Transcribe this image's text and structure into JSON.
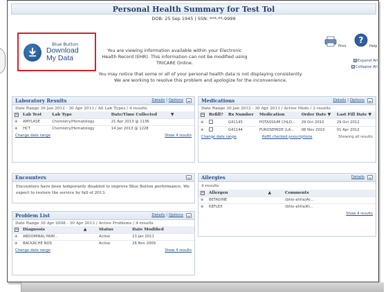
{
  "header": {
    "title": "Personal Health Summary for Test Tol",
    "dob_line": "DOB: 25 Sep 1945 | SSN: ***-**-9999"
  },
  "blue_button": {
    "line1": "Blue Button",
    "line2": "Download",
    "line3": "My Data"
  },
  "info_text": "You are viewing information available within your Electronic Health Record (EHR). This information can not be modified using TRICARE Online.",
  "notice_line1": "You may notice that some or all of your personal health data is not displaying consistently.",
  "notice_line2": "We are working to resolve this problem and apologize for the inconvenience.",
  "utilities": {
    "print_label": "Print",
    "help_label": "Help",
    "expand_all": "Expand All",
    "collapse_all": "Collapse All",
    "expand_marker": "⊞",
    "collapse_marker": "⊟"
  },
  "labs": {
    "title": "Laboratory Results",
    "details": "Details",
    "options": "Options",
    "range": "Date Range 30 Jan 2012 - 30 Apr 2013 / All Lab Types / 4 results",
    "headers": [
      "Lab Test",
      "Lab Type",
      "Date/Time Collected"
    ],
    "sort_arrow": "▼",
    "rows": [
      [
        "AMYLASE",
        "Chemistry/Hematology",
        "21 Apr 2013 @ 1136"
      ],
      [
        "HCT",
        "Chemistry/Hematology",
        "14 Jan 2013 @ 1228"
      ]
    ],
    "change_date": "Change date range",
    "show_all": "Show 4 results"
  },
  "meds": {
    "title": "Medications",
    "details": "Details",
    "options": "Options",
    "range": "Date Range 30 Jan 2012 - 30 Apr 2013 / Active Meds / 2 results",
    "headers": [
      "Refill?",
      "Rx Number",
      "Medication",
      "Order Date ▼",
      "Last Fill Date ▼"
    ],
    "rows": [
      [
        "G41145",
        "POTASSIUM CHLO...",
        "29 Oct 2010",
        "29 Oct 2012"
      ],
      [
        "G41144",
        "FUROSEMIDE (LA...",
        "08 Nov 2010",
        "01 Apr 2012"
      ]
    ],
    "change_date": "Change date range",
    "refill": "Refill checked prescriptions",
    "showing": "Showing all results"
  },
  "encounters": {
    "title": "Encounters",
    "message": "Encounters have been temporarily disabled to improve Blue Button performance. We expect to restore the service by fall of 2013."
  },
  "allergies": {
    "title": "Allergies",
    "details": "Details",
    "count": "4 results",
    "headers": [
      "Allergen",
      "Comments"
    ],
    "sort_arrow": "▲",
    "rows": [
      [
        "BETADINE",
        "(bhie-ahlta)Ac..."
      ],
      [
        "KEFLEX",
        "(bhie-ahlta)Ki..."
      ]
    ],
    "show_all": "Show 4 results"
  },
  "problems": {
    "title": "Problem List",
    "details": "Details",
    "options": "Options",
    "range": "Date Range 30 Apr 2008 - 30 Apr 2013 / Active Problems / 4 results",
    "headers": [
      "Diagnosis",
      "Status",
      "Date Modified"
    ],
    "sort_arrow": "▲",
    "rows": [
      [
        "ABDOMINAL PAIN...",
        "Active",
        "13 Jan 2011"
      ],
      [
        "BACKACHE NOS",
        "Active",
        "26 Nov 2009"
      ]
    ],
    "change_date": "Change date range",
    "show_all": "Show 4 results"
  },
  "colors": {
    "title_blue": "#2a3f6b",
    "link_blue": "#1d4d8e",
    "highlight_red": "#d51f26"
  }
}
